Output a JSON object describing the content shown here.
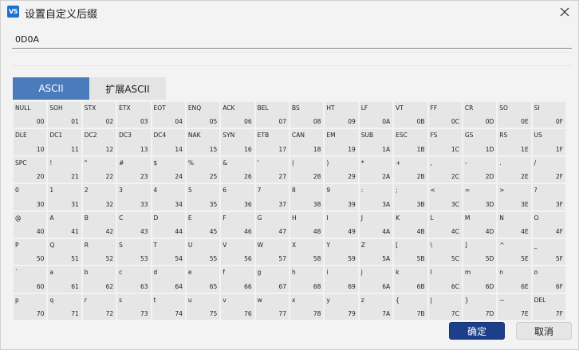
{
  "window": {
    "title": "设置自定义后缀",
    "icon_text": "VS"
  },
  "suffix_input": {
    "value": "0D0A"
  },
  "tabs": [
    {
      "label": "ASCII",
      "active": true
    },
    {
      "label": "扩展ASCII",
      "active": false
    }
  ],
  "ascii_cells": [
    {
      "name": "NULL",
      "hex": "00"
    },
    {
      "name": "SOH",
      "hex": "01"
    },
    {
      "name": "STX",
      "hex": "02"
    },
    {
      "name": "ETX",
      "hex": "03"
    },
    {
      "name": "EOT",
      "hex": "04"
    },
    {
      "name": "ENQ",
      "hex": "05"
    },
    {
      "name": "ACK",
      "hex": "06"
    },
    {
      "name": "BEL",
      "hex": "07"
    },
    {
      "name": "BS",
      "hex": "08"
    },
    {
      "name": "HT",
      "hex": "09"
    },
    {
      "name": "LF",
      "hex": "0A"
    },
    {
      "name": "VT",
      "hex": "0B"
    },
    {
      "name": "FF",
      "hex": "0C"
    },
    {
      "name": "CR",
      "hex": "0D"
    },
    {
      "name": "SO",
      "hex": "0E"
    },
    {
      "name": "SI",
      "hex": "0F"
    },
    {
      "name": "DLE",
      "hex": "10"
    },
    {
      "name": "DC1",
      "hex": "11"
    },
    {
      "name": "DC2",
      "hex": "12"
    },
    {
      "name": "DC3",
      "hex": "13"
    },
    {
      "name": "DC4",
      "hex": "14"
    },
    {
      "name": "NAK",
      "hex": "15"
    },
    {
      "name": "SYN",
      "hex": "16"
    },
    {
      "name": "ETB",
      "hex": "17"
    },
    {
      "name": "CAN",
      "hex": "18"
    },
    {
      "name": "EM",
      "hex": "19"
    },
    {
      "name": "SUB",
      "hex": "1A"
    },
    {
      "name": "ESC",
      "hex": "1B"
    },
    {
      "name": "FS",
      "hex": "1C"
    },
    {
      "name": "GS",
      "hex": "1D"
    },
    {
      "name": "RS",
      "hex": "1E"
    },
    {
      "name": "US",
      "hex": "1F"
    },
    {
      "name": "SPC",
      "hex": "20"
    },
    {
      "name": "!",
      "hex": "21"
    },
    {
      "name": "\"",
      "hex": "22"
    },
    {
      "name": "#",
      "hex": "23"
    },
    {
      "name": "$",
      "hex": "24"
    },
    {
      "name": "%",
      "hex": "25"
    },
    {
      "name": "&",
      "hex": "26"
    },
    {
      "name": "'",
      "hex": "27"
    },
    {
      "name": "(",
      "hex": "28"
    },
    {
      "name": ")",
      "hex": "29"
    },
    {
      "name": "*",
      "hex": "2A"
    },
    {
      "name": "+",
      "hex": "2B"
    },
    {
      "name": ",",
      "hex": "2C"
    },
    {
      "name": "-",
      "hex": "2D"
    },
    {
      "name": ".",
      "hex": "2E"
    },
    {
      "name": "/",
      "hex": "2F"
    },
    {
      "name": "0",
      "hex": "30"
    },
    {
      "name": "1",
      "hex": "31"
    },
    {
      "name": "2",
      "hex": "32"
    },
    {
      "name": "3",
      "hex": "33"
    },
    {
      "name": "4",
      "hex": "34"
    },
    {
      "name": "5",
      "hex": "35"
    },
    {
      "name": "6",
      "hex": "36"
    },
    {
      "name": "7",
      "hex": "37"
    },
    {
      "name": "8",
      "hex": "38"
    },
    {
      "name": "9",
      "hex": "39"
    },
    {
      "name": ":",
      "hex": "3A"
    },
    {
      "name": ";",
      "hex": "3B"
    },
    {
      "name": "<",
      "hex": "3C"
    },
    {
      "name": "=",
      "hex": "3D"
    },
    {
      "name": ">",
      "hex": "3E"
    },
    {
      "name": "?",
      "hex": "3F"
    },
    {
      "name": "@",
      "hex": "40"
    },
    {
      "name": "A",
      "hex": "41"
    },
    {
      "name": "B",
      "hex": "42"
    },
    {
      "name": "C",
      "hex": "43"
    },
    {
      "name": "D",
      "hex": "44"
    },
    {
      "name": "E",
      "hex": "45"
    },
    {
      "name": "F",
      "hex": "46"
    },
    {
      "name": "G",
      "hex": "47"
    },
    {
      "name": "H",
      "hex": "48"
    },
    {
      "name": "I",
      "hex": "49"
    },
    {
      "name": "J",
      "hex": "4A"
    },
    {
      "name": "K",
      "hex": "4B"
    },
    {
      "name": "L",
      "hex": "4C"
    },
    {
      "name": "M",
      "hex": "4D"
    },
    {
      "name": "N",
      "hex": "4E"
    },
    {
      "name": "O",
      "hex": "4F"
    },
    {
      "name": "P",
      "hex": "50"
    },
    {
      "name": "Q",
      "hex": "51"
    },
    {
      "name": "R",
      "hex": "52"
    },
    {
      "name": "S",
      "hex": "53"
    },
    {
      "name": "T",
      "hex": "54"
    },
    {
      "name": "U",
      "hex": "55"
    },
    {
      "name": "V",
      "hex": "56"
    },
    {
      "name": "W",
      "hex": "57"
    },
    {
      "name": "X",
      "hex": "58"
    },
    {
      "name": "Y",
      "hex": "59"
    },
    {
      "name": "Z",
      "hex": "5A"
    },
    {
      "name": "[",
      "hex": "5B"
    },
    {
      "name": "\\",
      "hex": "5C"
    },
    {
      "name": "]",
      "hex": "5D"
    },
    {
      "name": "^",
      "hex": "5E"
    },
    {
      "name": "_",
      "hex": "5F"
    },
    {
      "name": "`",
      "hex": "60"
    },
    {
      "name": "a",
      "hex": "61"
    },
    {
      "name": "b",
      "hex": "62"
    },
    {
      "name": "c",
      "hex": "63"
    },
    {
      "name": "d",
      "hex": "64"
    },
    {
      "name": "e",
      "hex": "65"
    },
    {
      "name": "f",
      "hex": "66"
    },
    {
      "name": "g",
      "hex": "67"
    },
    {
      "name": "h",
      "hex": "68"
    },
    {
      "name": "i",
      "hex": "69"
    },
    {
      "name": "j",
      "hex": "6A"
    },
    {
      "name": "k",
      "hex": "6B"
    },
    {
      "name": "l",
      "hex": "6C"
    },
    {
      "name": "m",
      "hex": "6D"
    },
    {
      "name": "n",
      "hex": "6E"
    },
    {
      "name": "o",
      "hex": "6F"
    },
    {
      "name": "p",
      "hex": "70"
    },
    {
      "name": "q",
      "hex": "71"
    },
    {
      "name": "r",
      "hex": "72"
    },
    {
      "name": "s",
      "hex": "73"
    },
    {
      "name": "t",
      "hex": "74"
    },
    {
      "name": "u",
      "hex": "75"
    },
    {
      "name": "v",
      "hex": "76"
    },
    {
      "name": "w",
      "hex": "77"
    },
    {
      "name": "x",
      "hex": "78"
    },
    {
      "name": "y",
      "hex": "79"
    },
    {
      "name": "z",
      "hex": "7A"
    },
    {
      "name": "{",
      "hex": "7B"
    },
    {
      "name": "|",
      "hex": "7C"
    },
    {
      "name": "}",
      "hex": "7D"
    },
    {
      "name": "~",
      "hex": "7E"
    },
    {
      "name": "DEL",
      "hex": "7F"
    }
  ],
  "buttons": {
    "ok": "确定",
    "cancel": "取消"
  },
  "colors": {
    "tab_active": "#4a7bbb",
    "ok_button": "#1d3f8a",
    "cell_bg": "#e6e6e6"
  }
}
